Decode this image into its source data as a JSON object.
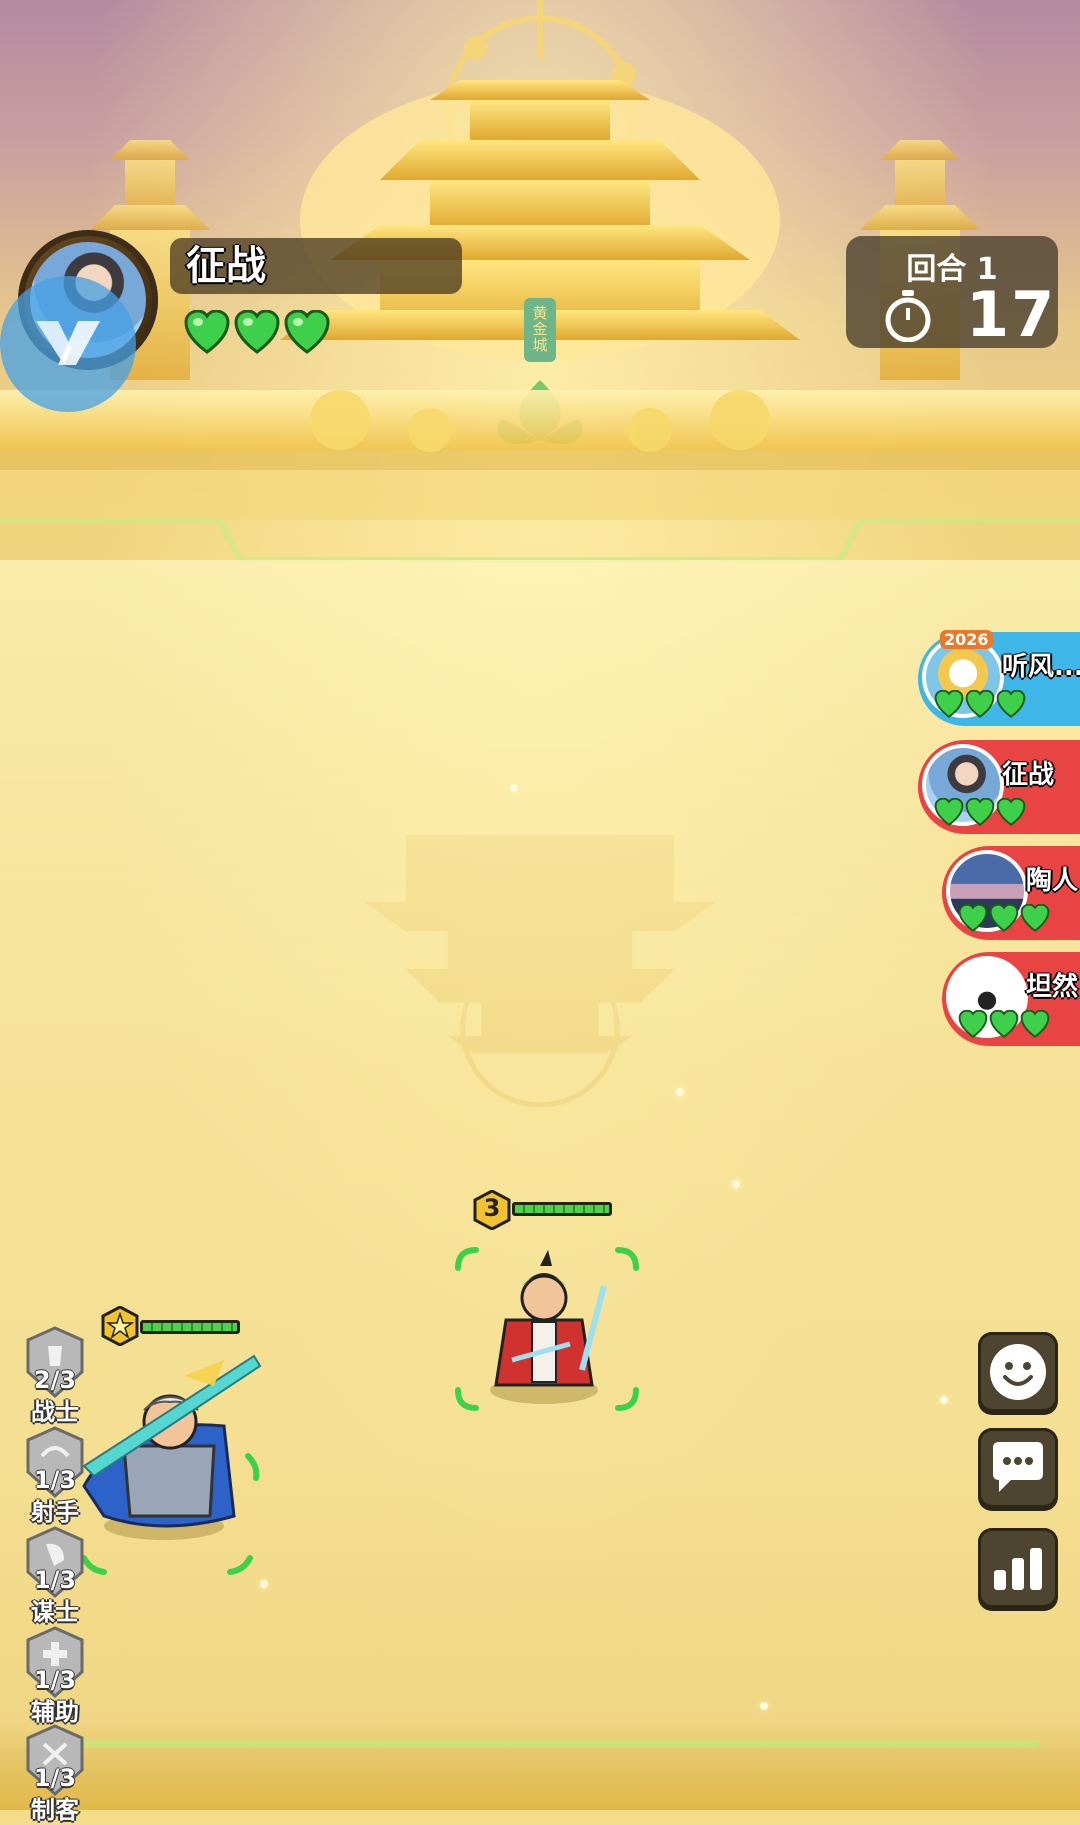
{
  "player": {
    "name": "征战",
    "hearts": 3
  },
  "round": {
    "label": "回合 1",
    "timer": "17"
  },
  "palace": {
    "plaque": "黄金城"
  },
  "opponents": [
    {
      "name": "听风...",
      "hearts": 3,
      "color": "#3fb6e8",
      "badge": "2026"
    },
    {
      "name": "征战",
      "hearts": 3,
      "color": "#e84444"
    },
    {
      "name": "陶人",
      "hearts": 3,
      "color": "#e84444"
    },
    {
      "name": "坦然",
      "hearts": 3,
      "color": "#e84444"
    }
  ],
  "classes": [
    {
      "count": "2/3",
      "name": "战士",
      "icon": "warrior-icon"
    },
    {
      "count": "1/3",
      "name": "射手",
      "icon": "archer-icon"
    },
    {
      "count": "1/3",
      "name": "谋士",
      "icon": "strategist-icon"
    },
    {
      "count": "1/3",
      "name": "辅助",
      "icon": "support-icon"
    },
    {
      "count": "1/3",
      "name": "制客",
      "icon": "assassin-icon"
    }
  ],
  "units": [
    {
      "id": "enemy-swordsman",
      "level": "3",
      "hp_percent": 100
    },
    {
      "id": "player-general",
      "level": "",
      "hp_percent": 100
    }
  ],
  "buttons": {
    "emote": "smiley-icon",
    "chat": "chat-bubble-icon",
    "stats": "bar-chart-icon"
  },
  "colors": {
    "heart_green": "#3ed04a",
    "panel_dark": "#463c2d",
    "opponent_blue": "#3fb6e8",
    "opponent_red": "#e84444"
  }
}
